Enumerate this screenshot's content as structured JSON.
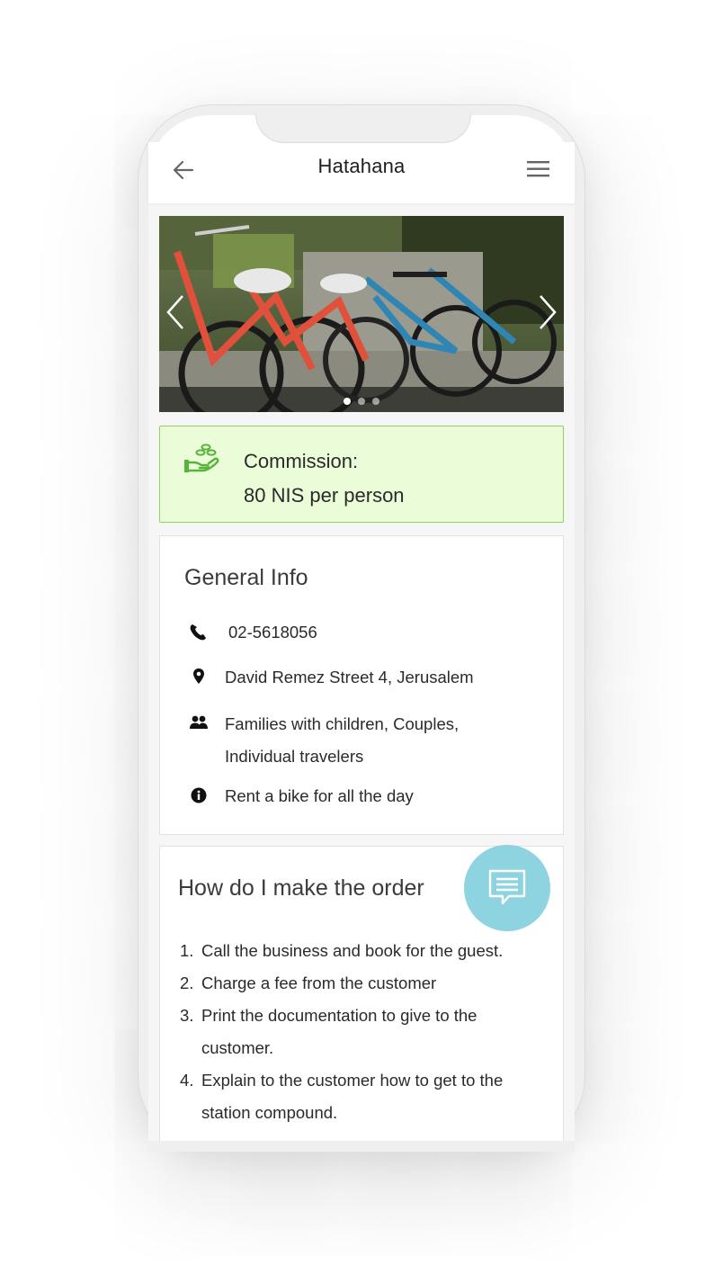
{
  "header": {
    "title": "Hatahana",
    "back_icon": "arrow-left-icon",
    "menu_icon": "hamburger-menu-icon"
  },
  "carousel": {
    "image": "bicycles-photo",
    "slide_count": 3,
    "active_slide": 1
  },
  "commission": {
    "icon": "hand-coins-icon",
    "label": "Commission:",
    "value": "80 NIS per person",
    "background_color": "#eafdd8",
    "border_color": "#8ed061"
  },
  "general_info": {
    "title": "General Info",
    "phone": "02-5618056",
    "address": "David Remez Street 4, Jerusalem",
    "audience_line1": "Families with children, Couples,",
    "audience_line2": "Individual travelers",
    "note": "Rent a bike for all the day"
  },
  "order": {
    "title": "How do I make the order",
    "steps": [
      {
        "num": "1.",
        "line1": "Call the business and book for the guest.",
        "line2": ""
      },
      {
        "num": "2.",
        "line1": "Charge a fee from the customer",
        "line2": ""
      },
      {
        "num": "3.",
        "line1": "Print the documentation to give to the",
        "line2": "customer."
      },
      {
        "num": "4.",
        "line1": "Explain to the customer how to get to the",
        "line2": "station compound."
      }
    ]
  },
  "chat_button": {
    "icon": "chat-bubble-icon",
    "color": "#8dd3e0"
  }
}
